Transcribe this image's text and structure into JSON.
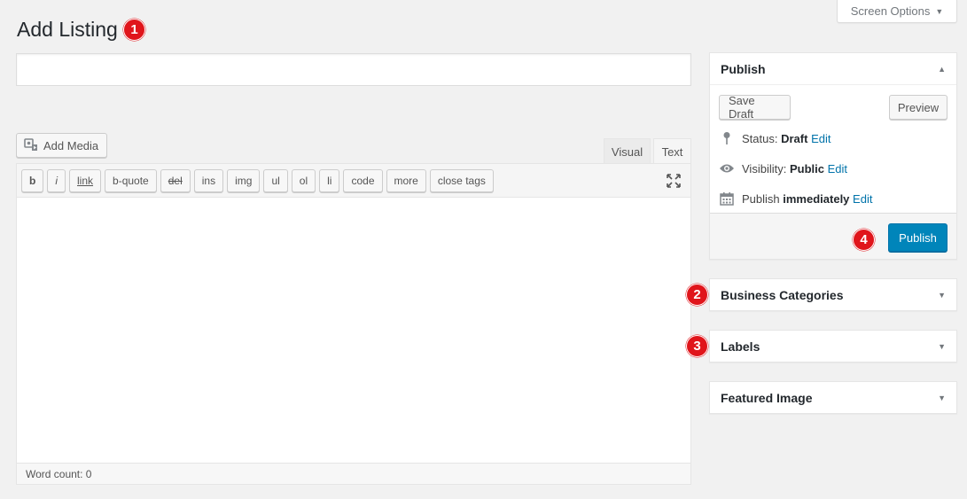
{
  "screen_options": {
    "label": "Screen Options"
  },
  "page": {
    "title": "Add Listing"
  },
  "badges": {
    "one": "1",
    "two": "2",
    "three": "3",
    "four": "4"
  },
  "editor": {
    "add_media": "Add Media",
    "tabs": {
      "visual": "Visual",
      "text": "Text"
    },
    "buttons": [
      "b",
      "i",
      "link",
      "b-quote",
      "del",
      "ins",
      "img",
      "ul",
      "ol",
      "li",
      "code",
      "more",
      "close tags"
    ],
    "word_count": "Word count: 0"
  },
  "publish": {
    "title": "Publish",
    "save_draft": "Save Draft",
    "preview": "Preview",
    "status_label": "Status:",
    "status_value": "Draft",
    "visibility_label": "Visibility:",
    "visibility_value": "Public",
    "publish_label": "Publish",
    "publish_value": "immediately",
    "edit": "Edit",
    "publish_button": "Publish"
  },
  "sidebar_boxes": {
    "business_categories": "Business Categories",
    "labels": "Labels",
    "featured_image": "Featured Image"
  },
  "colors": {
    "accent": "#0085ba",
    "badge": "#e0151b",
    "link": "#0073aa"
  }
}
